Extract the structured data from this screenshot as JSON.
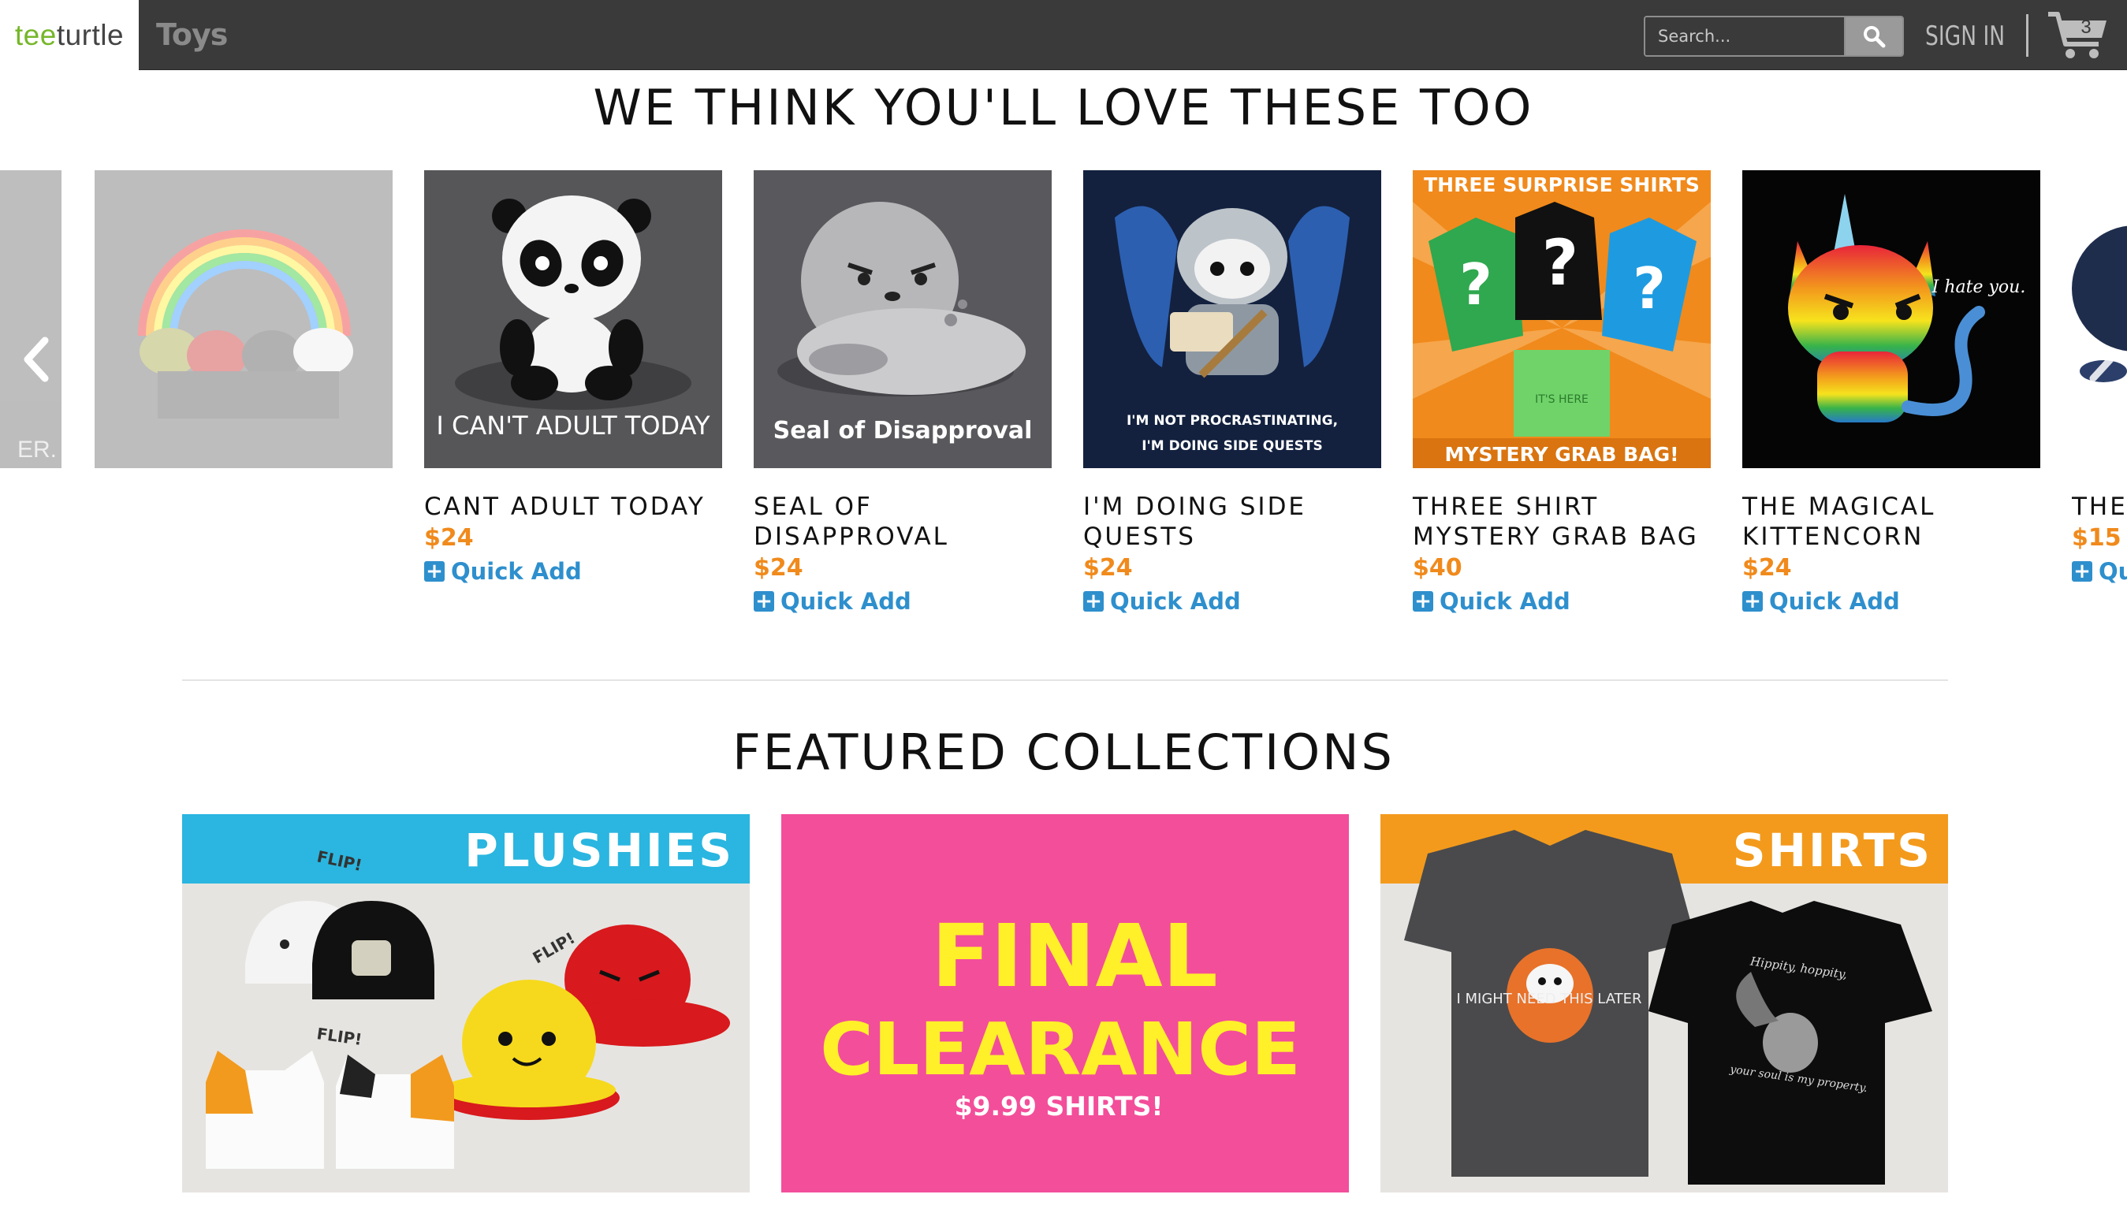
{
  "header": {
    "logo_part1": "tee",
    "logo_part2": "turtle",
    "nav_toys": "Toys",
    "search_placeholder": "Search...",
    "signin": "SIGN IN",
    "cart_count": "3"
  },
  "recommendations": {
    "title": "WE THINK YOU'LL LOVE THESE TOO",
    "partial_left_text": "ER.",
    "products": [
      {
        "name": "CANT ADULT TODAY",
        "price": "$24",
        "quick_add": "Quick Add",
        "art_text": "I CAN'T ADULT TODAY"
      },
      {
        "name": "SEAL OF DISAPPROVAL",
        "price": "$24",
        "quick_add": "Quick Add",
        "art_text": "Seal of Disapproval"
      },
      {
        "name": "I'M DOING SIDE QUESTS",
        "price": "$24",
        "quick_add": "Quick Add",
        "art_text_1": "I'M NOT PROCRASTINATING,",
        "art_text_2": "I'M DOING SIDE QUESTS"
      },
      {
        "name": "THREE SHIRT MYSTERY GRAB BAG",
        "price": "$40",
        "quick_add": "Quick Add",
        "art_top": "THREE SURPRISE SHIRTS",
        "art_bottom": "MYSTERY GRAB BAG!",
        "art_bag": "IT'S HERE"
      },
      {
        "name": "THE MAGICAL KITTENCORN",
        "price": "$24",
        "quick_add": "Quick Add",
        "art_text": "I hate you."
      },
      {
        "name": "THE REVE PLUS",
        "price": "$15",
        "quick_add": "Qu"
      }
    ]
  },
  "collections": {
    "title": "FEATURED COLLECTIONS",
    "plushies": {
      "label": "PLUSHIES",
      "flip": "FLIP!"
    },
    "clearance": {
      "line1": "FINAL",
      "line2": "CLEARANCE",
      "line3": "$9.99 SHIRTS!"
    },
    "shirts": {
      "label": "SHIRTS",
      "shirt1_text": "I MIGHT NEED THIS LATER",
      "shirt2_text_top": "Hippity, hoppity,",
      "shirt2_text_bottom": "your soul is my property."
    }
  },
  "colors": {
    "header_bg": "#3a3a3a",
    "price": "#f08a1c",
    "link": "#2e8fcd",
    "logo_green": "#76b72a"
  }
}
